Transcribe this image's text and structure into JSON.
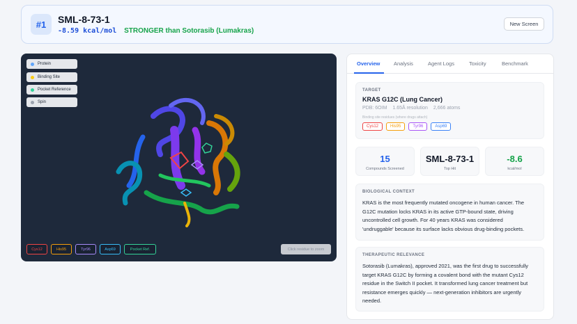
{
  "header": {
    "rank": "#1",
    "title": "SML-8-73-1",
    "score": "-8.59 kcal/mol",
    "verdict": "STRONGER than Sotorasib (Lumakras)",
    "new_screen": "New Screen"
  },
  "viewer": {
    "controls": [
      {
        "label": "Protein",
        "color": "#60a5fa"
      },
      {
        "label": "Binding Site",
        "color": "#facc15"
      },
      {
        "label": "Pocket Reference",
        "color": "#34d399"
      },
      {
        "label": "Spin",
        "color": "#9ca3af"
      }
    ],
    "chips": [
      {
        "label": "Cys12",
        "color": "#ef4444"
      },
      {
        "label": "His95",
        "color": "#f59e0b"
      },
      {
        "label": "Tyr96",
        "color": "#a78bfa"
      },
      {
        "label": "Asp69",
        "color": "#38bdf8"
      },
      {
        "label": "Pocket Ref.",
        "color": "#34d399"
      }
    ],
    "click_hint": "Click residue to zoom"
  },
  "tabs": [
    "Overview",
    "Analysis",
    "Agent Logs",
    "Toxicity",
    "Benchmark"
  ],
  "target": {
    "label": "TARGET",
    "name": "KRAS G12C (Lung Cancer)",
    "pdb": "PDB: 6OIM",
    "resolution": "1.65Å resolution",
    "atoms": "2,666 atoms",
    "note": "Binding site residues (where drugs attach)",
    "residues": [
      {
        "label": "Cys12",
        "color": "#ef4444"
      },
      {
        "label": "His95",
        "color": "#f59e0b"
      },
      {
        "label": "Tyr96",
        "color": "#a855f7"
      },
      {
        "label": "Asp69",
        "color": "#3b82f6"
      }
    ]
  },
  "stats": [
    {
      "value": "15",
      "label": "Compounds Screened",
      "color": "#2563eb"
    },
    {
      "value": "SML-8-73-1",
      "label": "Top Hit",
      "color": "#111827"
    },
    {
      "value": "-8.6",
      "label": "kcal/mol",
      "color": "#16a34a"
    }
  ],
  "bio": {
    "label": "BIOLOGICAL CONTEXT",
    "lines": [
      "KRAS is the most frequently mutated oncogene in human cancer. The",
      "G12C mutation locks KRAS in its active GTP-bound state, driving",
      "uncontrolled cell growth. For 40 years KRAS was considered",
      "'undruggable' because its surface lacks obvious drug-binding pockets."
    ]
  },
  "therapy": {
    "label": "THERAPEUTIC RELEVANCE",
    "lines": [
      "Sotorasib (Lumakras), approved 2021, was the first drug to successfully",
      "target KRAS G12C by forming a covalent bond with the mutant Cys12",
      "residue in the Switch II pocket. It transformed lung cancer treatment but",
      "resistance emerges quickly — next-generation inhibitors are urgently",
      "needed."
    ]
  }
}
